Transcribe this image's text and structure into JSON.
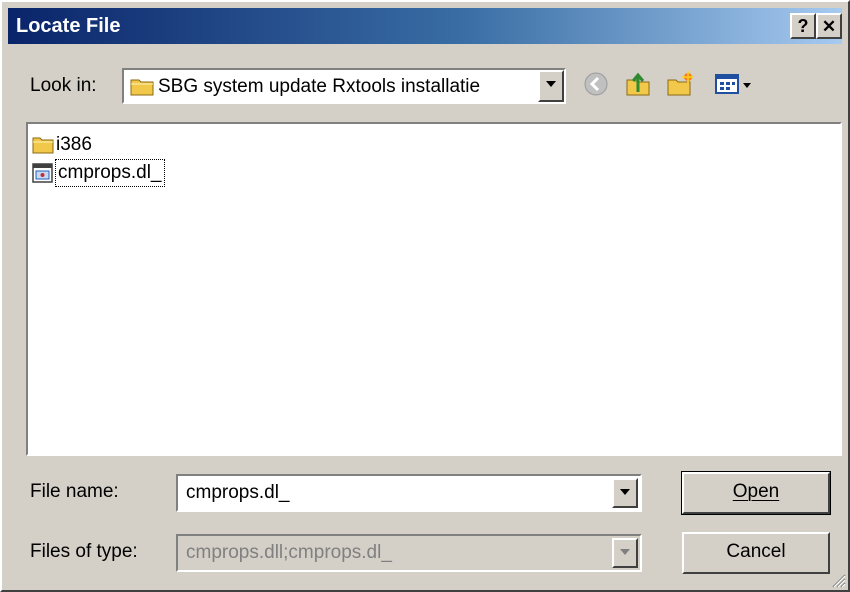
{
  "window": {
    "title": "Locate File",
    "help_label": "?",
    "close_label": "✕"
  },
  "look_in": {
    "label": "Look in:",
    "value": "SBG system update Rxtools installatie"
  },
  "files": [
    {
      "name": "i386",
      "type": "folder"
    },
    {
      "name": "cmprops.dl_",
      "type": "file"
    }
  ],
  "file_name": {
    "label": "File name:",
    "value": "cmprops.dl_"
  },
  "files_of_type": {
    "label": "Files of type:",
    "value": "cmprops.dll;cmprops.dl_"
  },
  "buttons": {
    "open": "Open",
    "cancel": "Cancel"
  },
  "colors": {
    "title_start": "#0a246a",
    "title_end": "#a6caf0",
    "face": "#d4d0c8",
    "folder": "#f2c84b"
  },
  "icons": {
    "back": "back-arrow-icon",
    "up": "up-folder-icon",
    "new_folder": "new-folder-icon",
    "view": "view-menu-icon"
  }
}
